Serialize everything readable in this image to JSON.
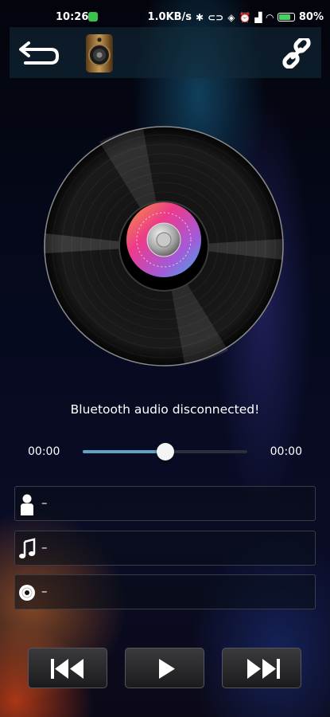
{
  "status_bar": {
    "time": "10:26",
    "network_speed": "1.0KB/s",
    "battery_percent": "80%",
    "battery_level": 0.8,
    "icons": [
      "bluetooth-icon",
      "vpn-key-icon",
      "vibrate-icon",
      "alarm-icon",
      "hd-signal-icon",
      "wifi-icon",
      "battery-charging-icon"
    ]
  },
  "toolbar": {
    "back_icon": "back-arrow-icon",
    "speaker_icon": "speaker-icon",
    "link_icon": "link-chain-icon"
  },
  "player": {
    "status_message": "Bluetooth audio disconnected!",
    "current_time": "00:00",
    "total_time": "00:00",
    "progress": 0.5
  },
  "track_info": {
    "artist": "–",
    "title": "–",
    "album": "–"
  },
  "controls": {
    "previous": "previous-track-icon",
    "play": "play-icon",
    "next": "next-track-icon"
  },
  "colors": {
    "accent": "#5fa3c2",
    "battery_green": "#46d35c"
  }
}
